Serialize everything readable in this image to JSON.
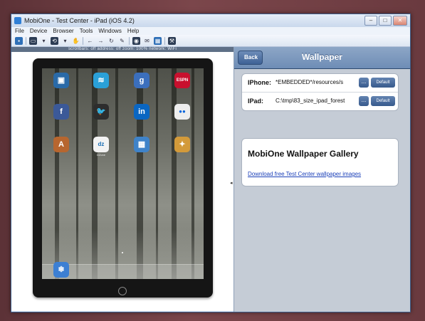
{
  "window": {
    "title": "MobiOne - Test Center - iPad (iOS 4.2)"
  },
  "menu": [
    "File",
    "Device",
    "Browser",
    "Tools",
    "Windows",
    "Help"
  ],
  "statusbar": {
    "text": "scrollbars: off    address: off    zoom: 100%    network: WiFi"
  },
  "ipad": {
    "apps": [
      {
        "label": "",
        "color": "#2a6aa8",
        "glyph": "▣",
        "icon": "phone-icon"
      },
      {
        "label": "",
        "color": "#2aa0d8",
        "glyph": "≋",
        "icon": "wifi-icon"
      },
      {
        "label": "",
        "color": "#3b6fbd",
        "glyph": "g",
        "icon": "google-icon"
      },
      {
        "label": "",
        "color": "#c8102e",
        "glyph": "ESPN",
        "icon": "espn-icon"
      },
      {
        "label": "",
        "color": "#3b5998",
        "glyph": "f",
        "icon": "facebook-icon"
      },
      {
        "label": "",
        "color": "#2d2d2d",
        "glyph": "🐦",
        "icon": "twitter-icon"
      },
      {
        "label": "",
        "color": "#0a66c2",
        "glyph": "in",
        "icon": "linkedin-icon"
      },
      {
        "label": "",
        "color": "#eeeeee",
        "glyph": "●●",
        "icon": "flickr-icon"
      },
      {
        "label": "",
        "color": "#b7662f",
        "glyph": "A",
        "icon": "app-store-icon"
      },
      {
        "label": "DZone",
        "color": "#f3f3f3",
        "glyph": "dz",
        "icon": "dzone-icon"
      },
      {
        "label": "",
        "color": "#3f83c9",
        "glyph": "▦",
        "icon": "photos-icon"
      },
      {
        "label": "",
        "color": "#d39a3a",
        "glyph": "✦",
        "icon": "app-icon"
      }
    ],
    "dock": [
      {
        "label": "",
        "color": "#3c7fd3",
        "glyph": "❄",
        "icon": "compass-icon"
      }
    ]
  },
  "panel": {
    "back": "Back",
    "title": "Wallpaper",
    "rows": [
      {
        "label": "IPhone:",
        "value": "*EMBEDDED*/resources/s",
        "dots": "...",
        "default": "Default"
      },
      {
        "label": "IPad:",
        "value": "C:\\tmp\\83_size_ipad_forest",
        "dots": "...",
        "default": "Default"
      }
    ],
    "gallery_title": "MobiOne Wallpaper Gallery",
    "gallery_link": "Download free Test Center wallpaper images"
  }
}
